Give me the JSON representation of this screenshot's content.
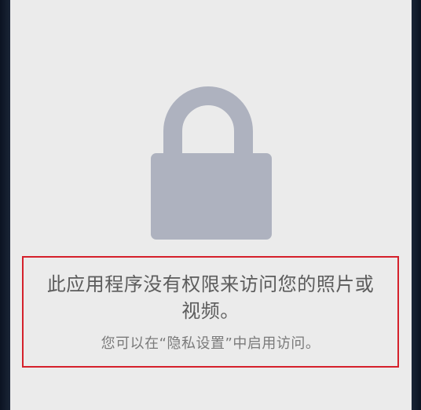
{
  "permission_notice": {
    "icon": "lock-icon",
    "message_line1": "此应用程序没有权限来访问您的照片或",
    "message_line2": "视频。",
    "hint": "您可以在“隐私设置”中启用访问。"
  },
  "colors": {
    "background": "#ebebeb",
    "lock": "#aeb2bf",
    "highlight_border": "#d5202b",
    "text_primary": "#5c5c5c",
    "text_secondary": "#7a7a7a"
  }
}
